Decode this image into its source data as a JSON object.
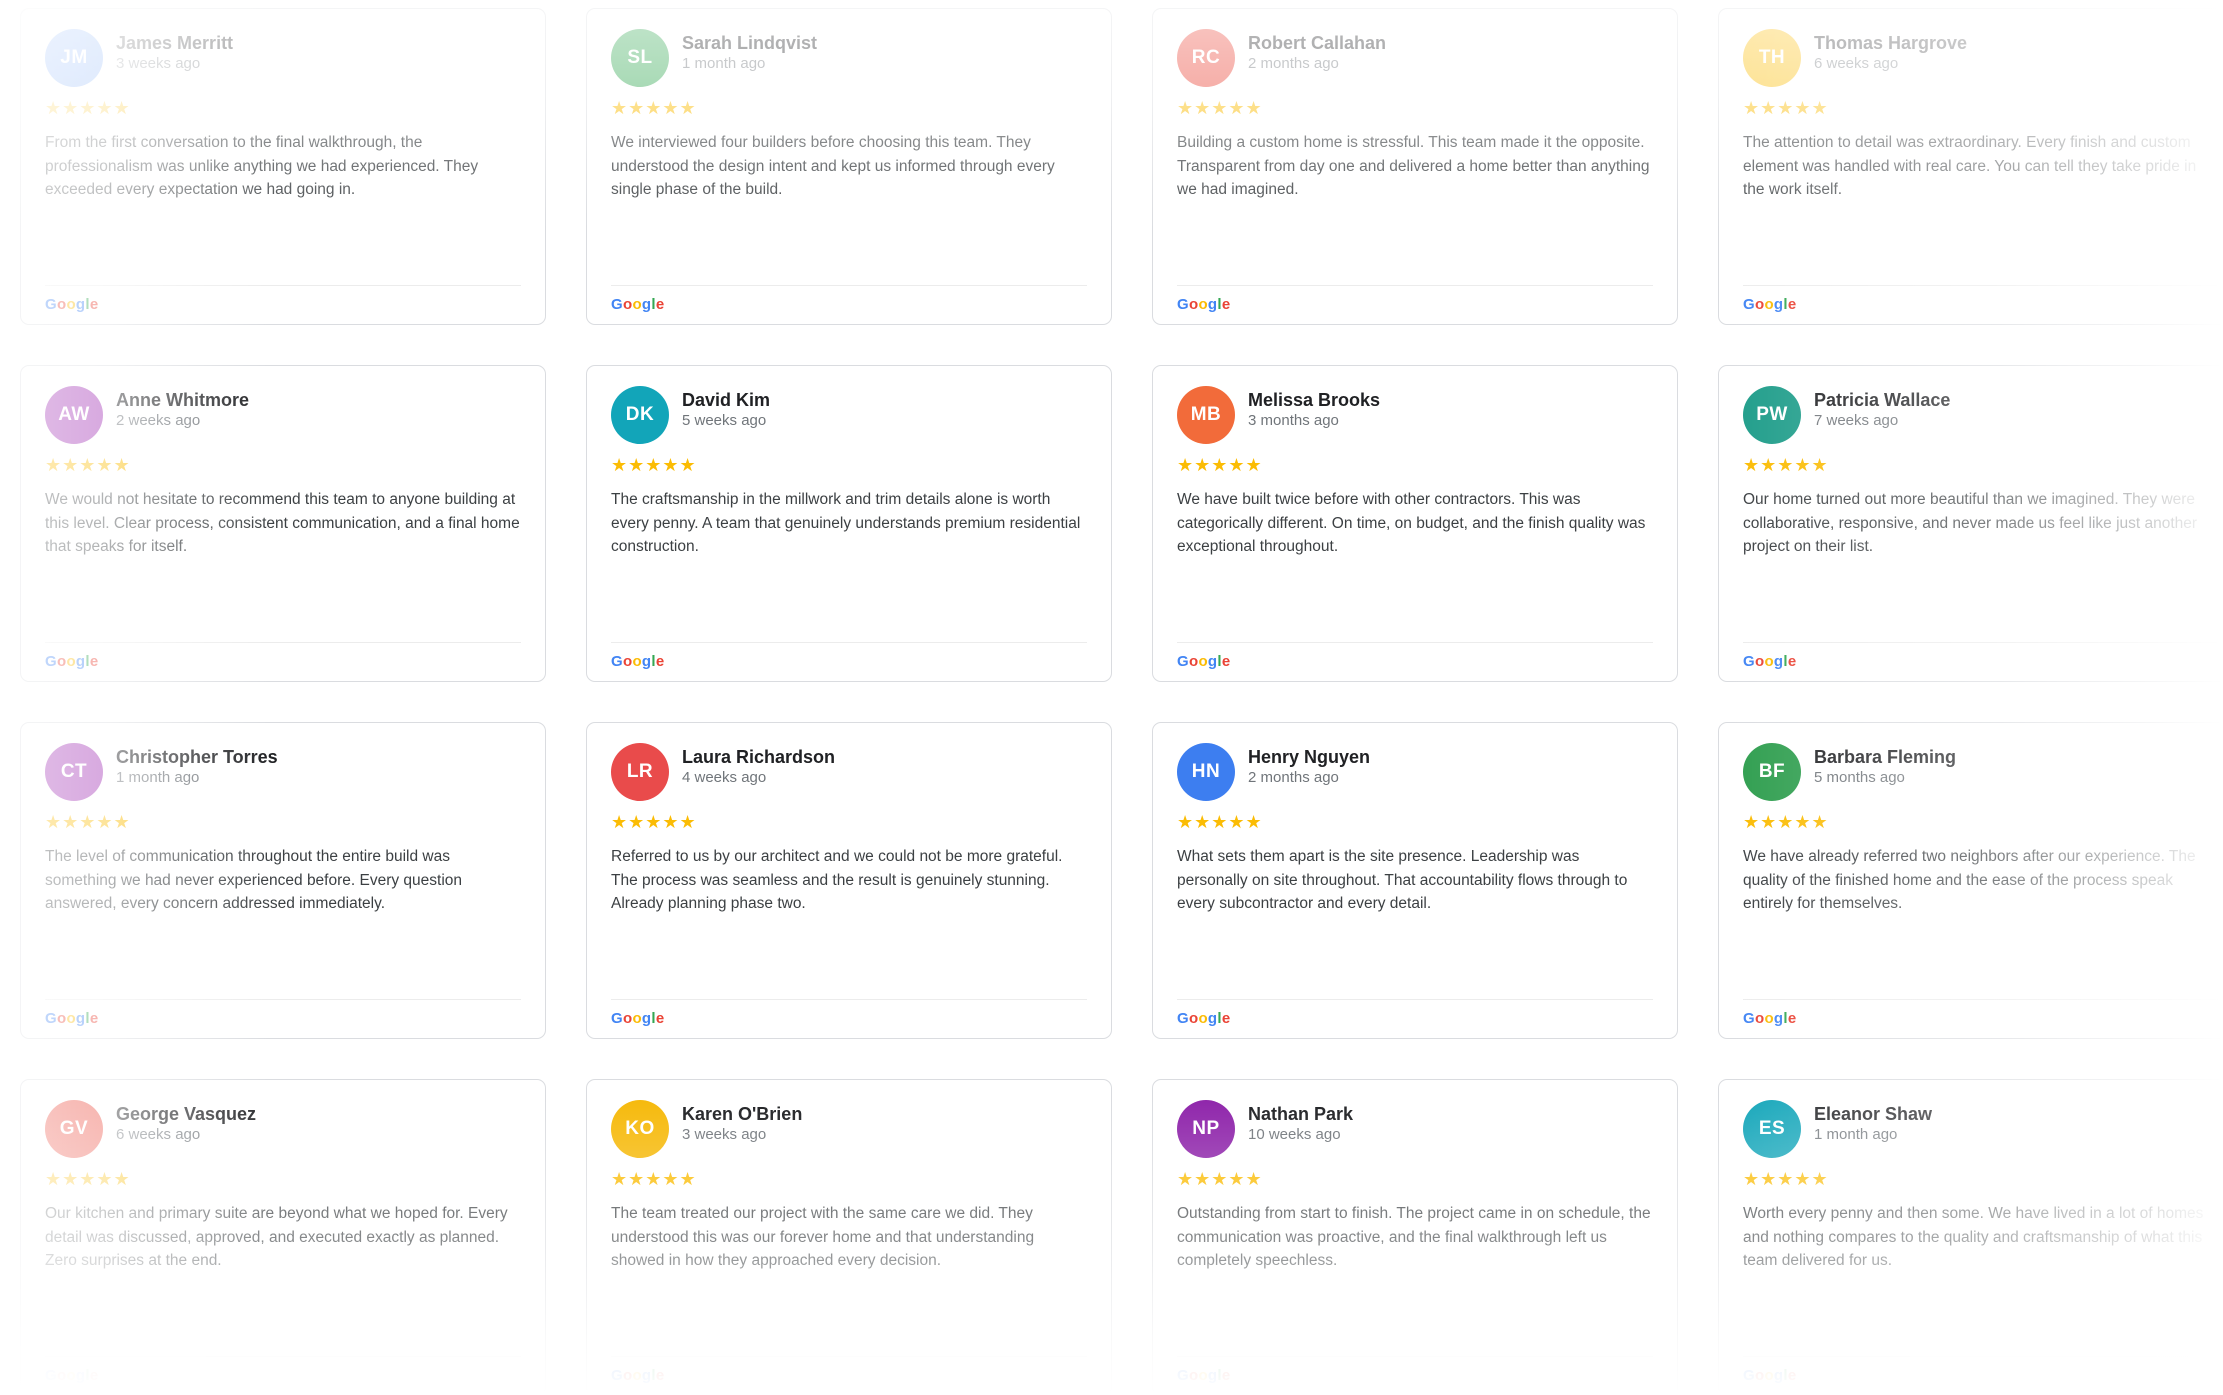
{
  "colors": {
    "star": "#fbbc04",
    "google_blue": "#4285f4",
    "google_red": "#ea4335",
    "google_yellow": "#fbbc05",
    "google_green": "#34a853"
  },
  "source_label": "Google",
  "reviews": [
    {
      "initials": "JM",
      "name": "James Merritt",
      "time": "3 weeks ago",
      "stars": "★★★★★",
      "rating": 5,
      "avatar_color": "#4285f4",
      "text": "From the first conversation to the final walkthrough, the professionalism was unlike anything we had experienced. They exceeded every expectation we had going in."
    },
    {
      "initials": "SL",
      "name": "Sarah Lindqvist",
      "time": "1 month ago",
      "stars": "★★★★★",
      "rating": 5,
      "avatar_color": "#34a853",
      "text": "We interviewed four builders before choosing this team. They understood the design intent and kept us informed through every single phase of the build."
    },
    {
      "initials": "RC",
      "name": "Robert Callahan",
      "time": "2 months ago",
      "stars": "★★★★★",
      "rating": 5,
      "avatar_color": "#ea4335",
      "text": "Building a custom home is stressful. This team made it the opposite. Transparent from day one and delivered a home better than anything we had imagined."
    },
    {
      "initials": "TH",
      "name": "Thomas Hargrove",
      "time": "6 weeks ago",
      "stars": "★★★★★",
      "rating": 5,
      "avatar_color": "#fbbc04",
      "text": "The attention to detail was extraordinary. Every finish and custom element was handled with real care. You can tell they take pride in the work itself."
    },
    {
      "initials": "AW",
      "name": "Anne Whitmore",
      "time": "2 weeks ago",
      "stars": "★★★★★",
      "rating": 5,
      "avatar_color": "#9c27b0",
      "text": "We would not hesitate to recommend this team to anyone building at this level. Clear process, consistent communication, and a final home that speaks for itself."
    },
    {
      "initials": "DK",
      "name": "David Kim",
      "time": "5 weeks ago",
      "stars": "★★★★★",
      "rating": 5,
      "avatar_color": "#12a5b9",
      "text": "The craftsmanship in the millwork and trim details alone is worth every penny. A team that genuinely understands premium residential construction."
    },
    {
      "initials": "MB",
      "name": "Melissa Brooks",
      "time": "3 months ago",
      "stars": "★★★★★",
      "rating": 5,
      "avatar_color": "#f26b3a",
      "text": "We have built twice before with other contractors. This was categorically different. On time, on budget, and the finish quality was exceptional throughout."
    },
    {
      "initials": "PW",
      "name": "Patricia Wallace",
      "time": "7 weeks ago",
      "stars": "★★★★★",
      "rating": 5,
      "avatar_color": "#1f9d8a",
      "text": "Our home turned out more beautiful than we imagined. They were collaborative, responsive, and never made us feel like just another project on their list."
    },
    {
      "initials": "CT",
      "name": "Christopher Torres",
      "time": "1 month ago",
      "stars": "★★★★★",
      "rating": 5,
      "avatar_color": "#9c27b0",
      "text": "The level of communication throughout the entire build was something we had never experienced before. Every question answered, every concern addressed immediately."
    },
    {
      "initials": "LR",
      "name": "Laura Richardson",
      "time": "4 weeks ago",
      "stars": "★★★★★",
      "rating": 5,
      "avatar_color": "#e94b4b",
      "text": "Referred to us by our architect and we could not be more grateful. The process was seamless and the result is genuinely stunning. Already planning phase two."
    },
    {
      "initials": "HN",
      "name": "Henry Nguyen",
      "time": "2 months ago",
      "stars": "★★★★★",
      "rating": 5,
      "avatar_color": "#3d7ef0",
      "text": "What sets them apart is the site presence. Leadership was personally on site throughout. That accountability flows through to every subcontractor and every detail."
    },
    {
      "initials": "BF",
      "name": "Barbara Fleming",
      "time": "5 months ago",
      "stars": "★★★★★",
      "rating": 5,
      "avatar_color": "#2f9e4f",
      "text": "We have already referred two neighbors after our experience. The quality of the finished home and the ease of the process speak entirely for themselves."
    },
    {
      "initials": "GV",
      "name": "George Vasquez",
      "time": "6 weeks ago",
      "stars": "★★★★★",
      "rating": 5,
      "avatar_color": "#ea4335",
      "text": "Our kitchen and primary suite are beyond what we hoped for. Every detail was discussed, approved, and executed exactly as planned. Zero surprises at the end."
    },
    {
      "initials": "KO",
      "name": "Karen O'Brien",
      "time": "3 weeks ago",
      "stars": "★★★★★",
      "rating": 5,
      "avatar_color": "#f6b90a",
      "text": "The team treated our project with the same care we did. They understood this was our forever home and that understanding showed in how they approached every decision."
    },
    {
      "initials": "NP",
      "name": "Nathan Park",
      "time": "10 weeks ago",
      "stars": "★★★★★",
      "rating": 5,
      "avatar_color": "#8e24aa",
      "text": "Outstanding from start to finish. The project came in on schedule, the communication was proactive, and the final walkthrough left us completely speechless."
    },
    {
      "initials": "ES",
      "name": "Eleanor Shaw",
      "time": "1 month ago",
      "stars": "★★★★★",
      "rating": 5,
      "avatar_color": "#12a5b9",
      "text": "Worth every penny and then some. We have lived in a lot of homes and nothing compares to the quality and craftsmanship of what this team delivered for us."
    }
  ]
}
